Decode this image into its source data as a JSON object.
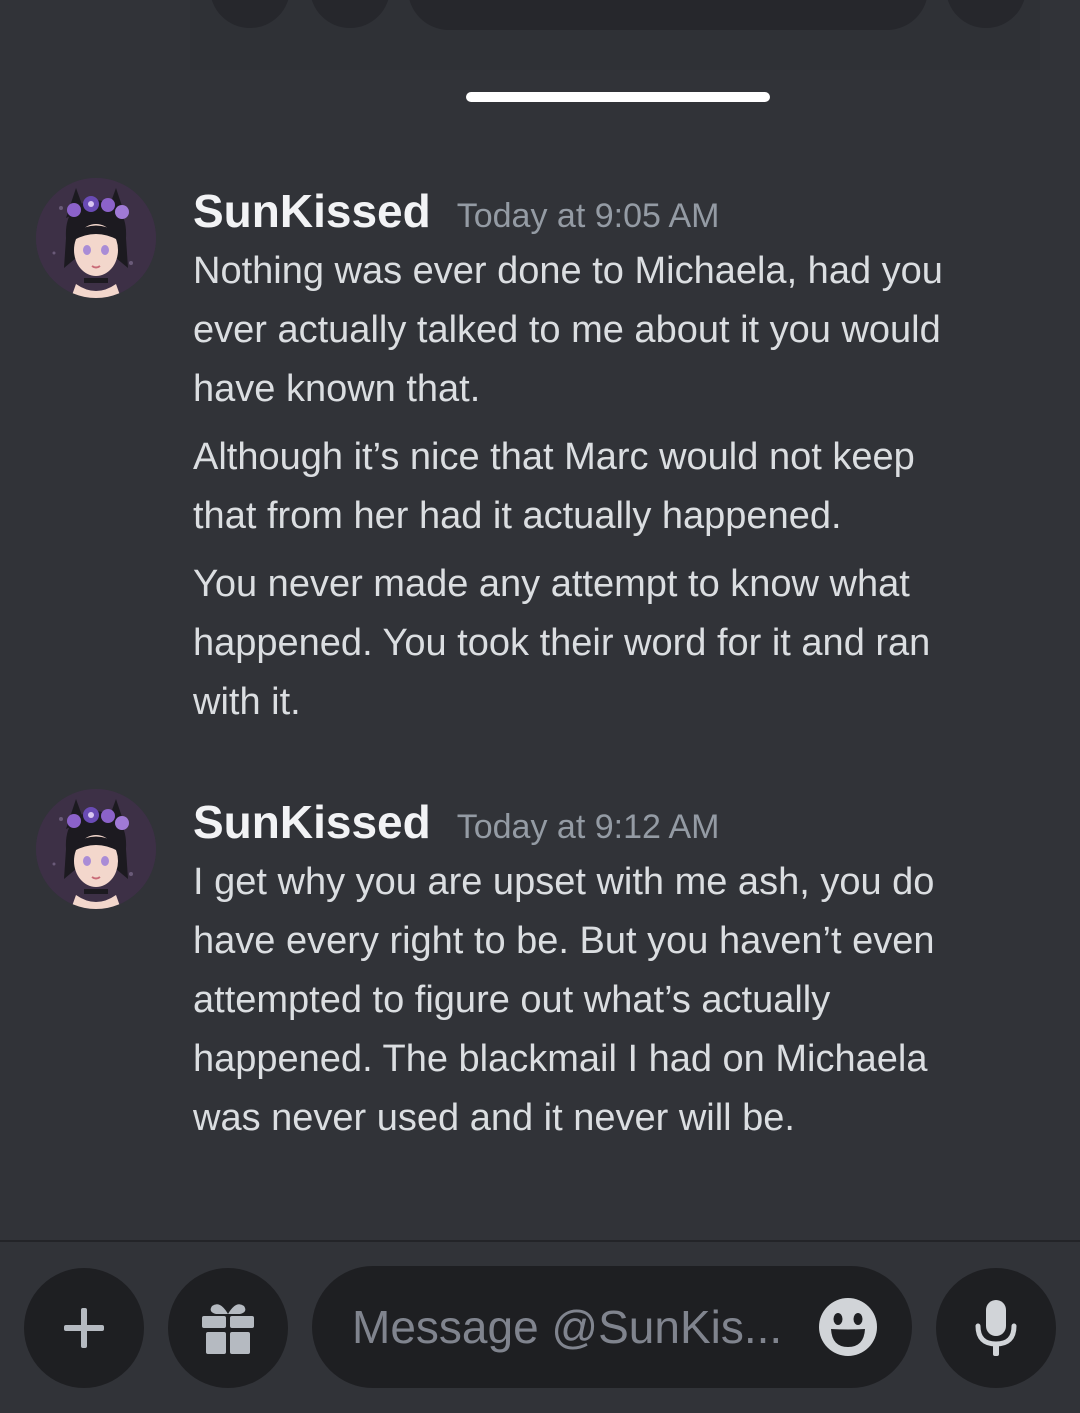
{
  "composer": {
    "placeholder": "Message @SunKis..."
  },
  "messages": [
    {
      "author": "SunKissed",
      "timestamp": "Today at 9:05 AM",
      "paragraphs": [
        [
          "Nothing was ever done to Michaela, had you",
          "ever actually talked to me about it you would",
          "have known that."
        ],
        [
          "Although it’s nice that Marc would not keep",
          "that from her had it actually happened."
        ],
        [
          "You never made any attempt to know what",
          "happened. You took their word for it and ran",
          "with it."
        ]
      ]
    },
    {
      "author": "SunKissed",
      "timestamp": "Today at 9:12 AM",
      "paragraphs": [
        [
          "I get why you are upset with me ash, you do",
          "have every right to be. But you haven’t even",
          "attempted to figure out what’s actually",
          "happened. The blackmail I had on Michaela",
          "was never used and it never will be."
        ]
      ]
    }
  ],
  "icons": {
    "attach": "plus-icon",
    "gift": "gift-icon",
    "emoji": "smiley-icon",
    "voice": "microphone-icon",
    "avatar": "avatar-icon"
  },
  "colors": {
    "background": "#313338",
    "input_bg": "#1e1f22",
    "username": "#f2f3f5",
    "message_text": "#dbdee1",
    "muted": "#949ba4"
  }
}
